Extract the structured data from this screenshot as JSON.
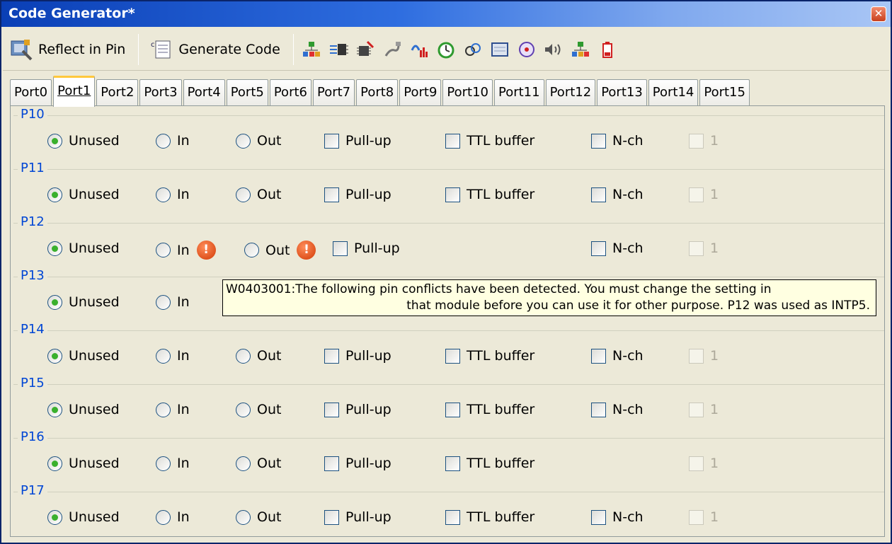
{
  "window": {
    "title": "Code Generator*"
  },
  "toolbar": {
    "reflect_label": "Reflect in Pin",
    "generate_label": "Generate Code",
    "icons": [
      "clock-generator-icon",
      "port-icon",
      "chip-icon",
      "serial-icon",
      "signal-icon",
      "timer-icon",
      "interrupt-icon",
      "lcd-icon",
      "watch-icon",
      "sound-icon",
      "network-icon",
      "battery-icon"
    ]
  },
  "tabs": [
    "Port0",
    "Port1",
    "Port2",
    "Port3",
    "Port4",
    "Port5",
    "Port6",
    "Port7",
    "Port8",
    "Port9",
    "Port10",
    "Port11",
    "Port12",
    "Port13",
    "Port14",
    "Port15"
  ],
  "active_tab": "Port1",
  "labels": {
    "unused": "Unused",
    "in": "In",
    "out": "Out",
    "pullup": "Pull-up",
    "ttl": "TTL buffer",
    "nch": "N-ch",
    "one": "1"
  },
  "pins": [
    {
      "name": "P10",
      "selected": "Unused",
      "ttl": true,
      "nch": true
    },
    {
      "name": "P11",
      "selected": "Unused",
      "ttl": true,
      "nch": true
    },
    {
      "name": "P12",
      "selected": "Unused",
      "ttl": false,
      "nch": true,
      "warning": true
    },
    {
      "name": "P13",
      "selected": "Unused"
    },
    {
      "name": "P14",
      "selected": "Unused",
      "ttl": true,
      "nch": true
    },
    {
      "name": "P15",
      "selected": "Unused",
      "ttl": true,
      "nch": true
    },
    {
      "name": "P16",
      "selected": "Unused",
      "ttl": true,
      "nch": false
    },
    {
      "name": "P17",
      "selected": "Unused",
      "ttl": true,
      "nch": true
    }
  ],
  "tooltip": {
    "line1": "W0403001:The following pin conflicts have been detected. You must change the setting in",
    "line2": "that module before you can use it for other purpose. P12 was used as INTP5."
  },
  "warning_glyph": "!"
}
